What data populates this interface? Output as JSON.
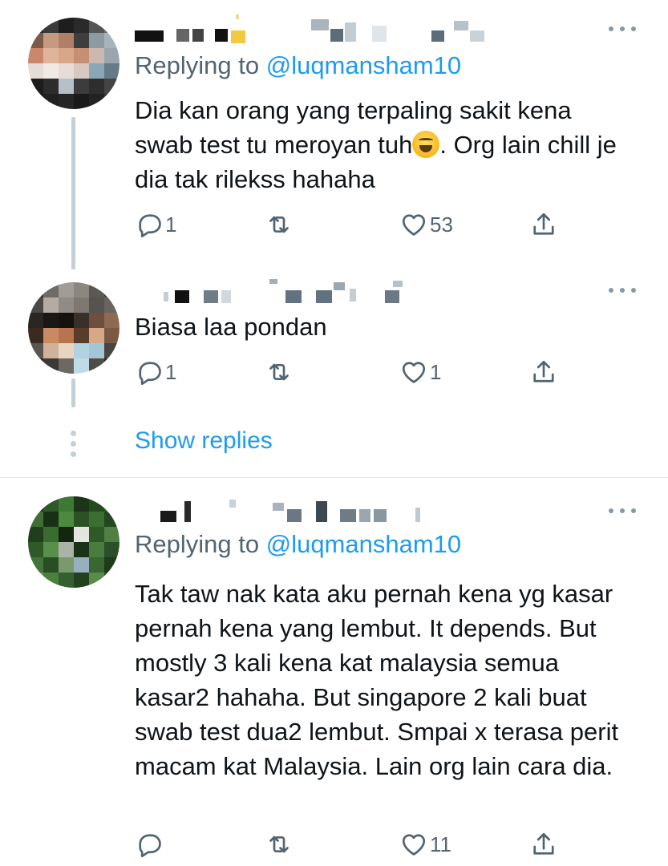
{
  "colors": {
    "accent": "#1d9bf0",
    "muted": "#536471",
    "text": "#0f1419",
    "thread_line": "#c4cfd6"
  },
  "tweets": [
    {
      "reply_prefix": "Replying to ",
      "reply_handle": "@luqmansham10",
      "text_before_emoji": "Dia kan orang yang terpaling sakit kena swab test tu meroyan tuh",
      "emoji": "face-with-tears-of-joy-emoji",
      "text_after_emoji": ". Org lain chill je dia tak rilekss hahaha",
      "reply_count": "1",
      "retweet_count": "",
      "like_count": "53"
    },
    {
      "text": "Biasa laa pondan",
      "reply_count": "1",
      "retweet_count": "",
      "like_count": "1"
    },
    {
      "reply_prefix": "Replying to ",
      "reply_handle": "@luqmansham10",
      "text": "Tak taw nak kata aku pernah kena yg kasar pernah kena yang lembut. It depends. But mostly 3 kali kena kat malaysia semua kasar2 hahaha. But singapore 2 kali buat swab test dua2 lembut. Smpai x terasa perit macam kat Malaysia. Lain org lain cara dia.",
      "reply_count": "",
      "retweet_count": "",
      "like_count": "11"
    }
  ],
  "show_replies_label": "Show replies"
}
